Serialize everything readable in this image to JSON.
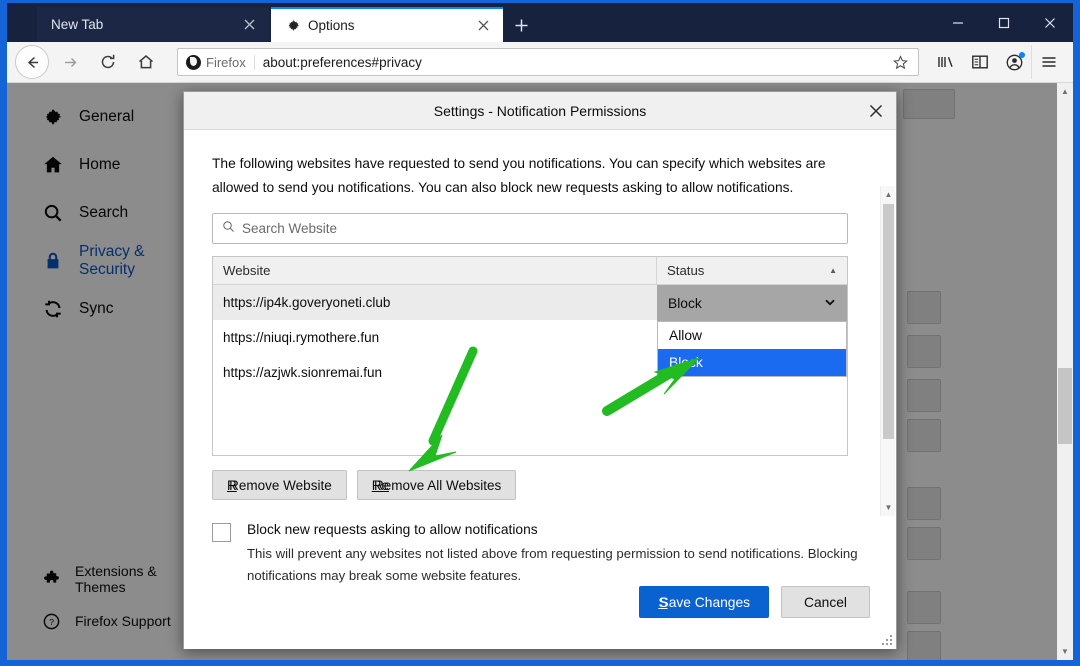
{
  "browser": {
    "tabs": [
      {
        "title": "New Tab",
        "active": false,
        "favicon": "none"
      },
      {
        "title": "Options",
        "active": true,
        "favicon": "gear-icon"
      }
    ],
    "new_tab_label": "+",
    "window_controls": {
      "minimize": "—",
      "maximize": "□",
      "close": "✕"
    },
    "urlbar": {
      "identity_label": "Firefox",
      "url": "about:preferences#privacy"
    },
    "toolbar_icons": [
      "library-icon",
      "sidebar-icon",
      "account-icon",
      "hamburger-menu-icon"
    ],
    "account_has_badge": true
  },
  "preferences_sidebar": {
    "items": [
      {
        "label": "General",
        "icon": "gear-icon",
        "selected": false
      },
      {
        "label": "Home",
        "icon": "home-icon",
        "selected": false
      },
      {
        "label": "Search",
        "icon": "search-icon",
        "selected": false
      },
      {
        "label": "Privacy & Security",
        "icon": "lock-icon",
        "selected": true
      },
      {
        "label": "Sync",
        "icon": "sync-icon",
        "selected": false
      }
    ],
    "bottom_items": [
      {
        "label": "Extensions & Themes",
        "icon": "puzzle-icon"
      },
      {
        "label": "Firefox Support",
        "icon": "question-circle-icon"
      }
    ]
  },
  "dialog": {
    "title": "Settings - Notification Permissions",
    "close_label": "✕",
    "intro": "The following websites have requested to send you notifications. You can specify which websites are allowed to send you notifications. You can also block new requests asking to allow notifications.",
    "search": {
      "placeholder": "Search Website",
      "value": "",
      "icon": "search-icon"
    },
    "table": {
      "columns": [
        "Website",
        "Status"
      ],
      "sort_column": "Status",
      "sort_direction": "ascending",
      "rows": [
        {
          "website": "https://ip4k.goveryoneti.club",
          "status": "Block",
          "selected": true
        },
        {
          "website": "https://niuqi.rymothere.fun",
          "status": "",
          "selected": false
        },
        {
          "website": "https://azjwk.sionremai.fun",
          "status": "",
          "selected": false
        }
      ]
    },
    "status_select": {
      "value": "Block",
      "open": true,
      "chevron": "chevron-down-icon",
      "options": [
        {
          "label": "Allow",
          "highlighted": false
        },
        {
          "label": "Block",
          "highlighted": true
        }
      ],
      "obscured_option": "Allow"
    },
    "buttons": {
      "remove_website": "Remove Website",
      "remove_all_websites": "Remove All Websites",
      "save_changes": "Save Changes",
      "cancel": "Cancel"
    },
    "checkbox": {
      "checked": false,
      "label": "Block new requests asking to allow notifications",
      "description": "This will prevent any websites not listed above from requesting permission to send notifications. Blocking notifications may break some website features."
    }
  },
  "annotations": {
    "arrow_color": "#22bb22",
    "arrows": [
      {
        "name": "arrow-to-remove-all-websites",
        "points_to": "Remove All Websites"
      },
      {
        "name": "arrow-to-block-option",
        "points_to": "Block"
      }
    ]
  },
  "colors": {
    "accent": "#0a62d0",
    "highlight": "#1a6bf0",
    "titlebar": "#16223e",
    "frame": "#1464d8",
    "annotation_green": "#22bb22"
  }
}
